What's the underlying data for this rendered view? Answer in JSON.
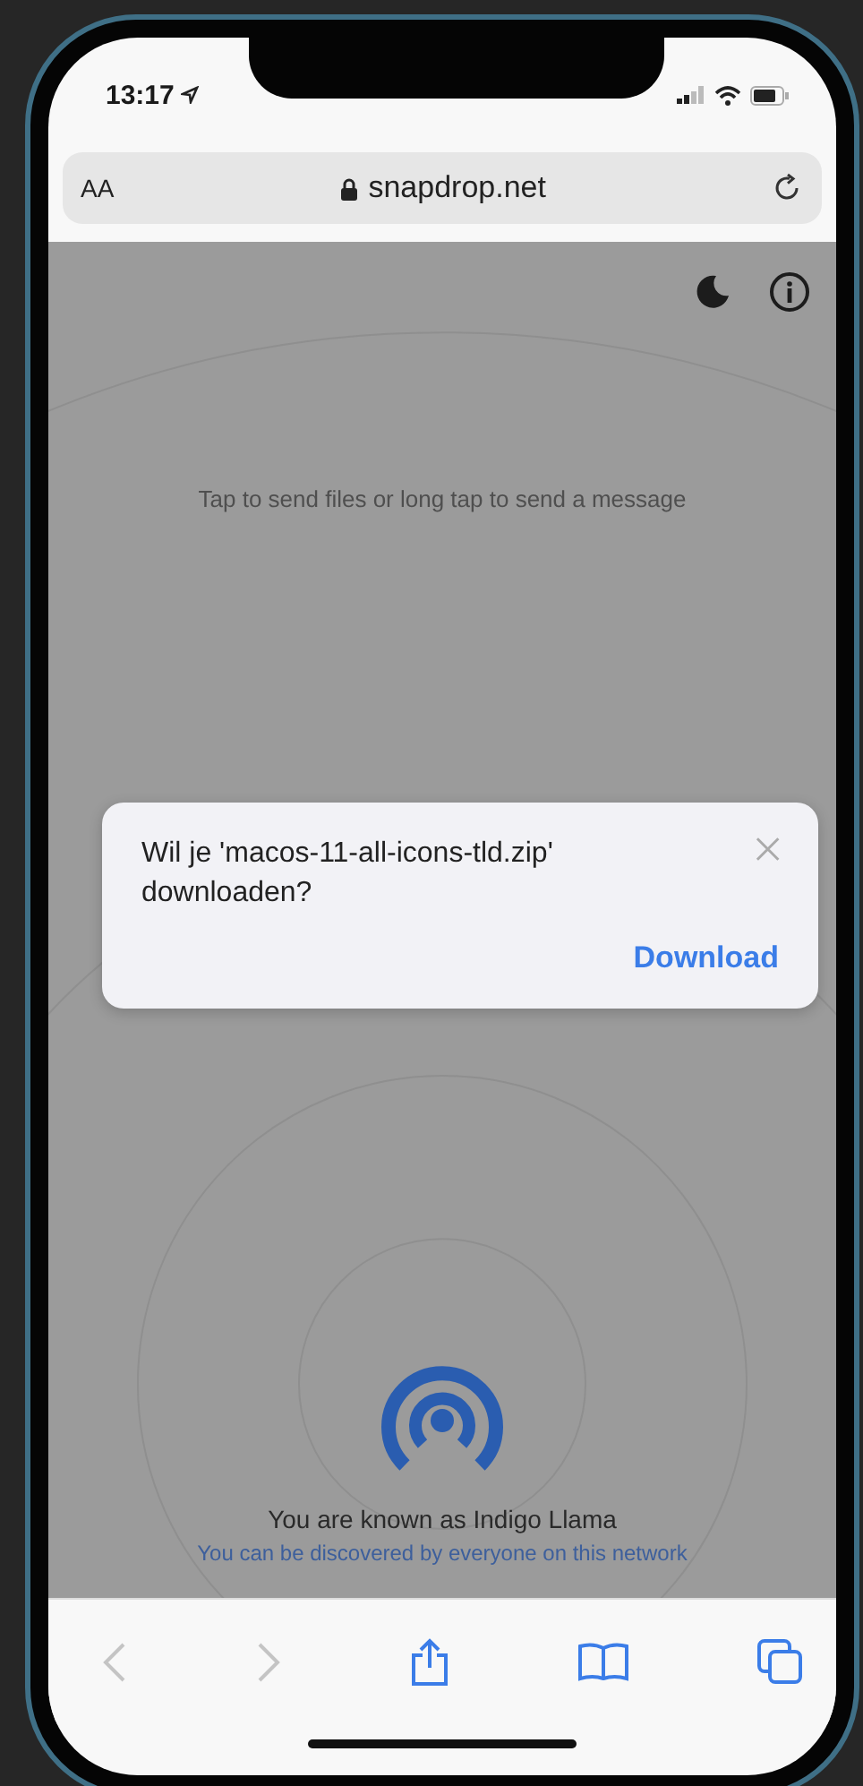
{
  "status_bar": {
    "time": "13:17"
  },
  "address_bar": {
    "text_size": "AA",
    "url": "snapdrop.net"
  },
  "page": {
    "hint": "Tap to send files or long tap to send a message",
    "device_name": "You are known as Indigo Llama",
    "discovery": "You can be discovered by everyone on this network"
  },
  "dialog": {
    "message": "Wil je 'macos-11-all-icons-tld.zip' downloaden?",
    "action": "Download"
  },
  "toolbar": [
    {
      "kind": "back",
      "disabled": true
    },
    {
      "kind": "forward",
      "disabled": true
    },
    {
      "kind": "share",
      "disabled": false
    },
    {
      "kind": "bookmarks",
      "disabled": false
    },
    {
      "kind": "tabs",
      "disabled": false
    }
  ]
}
